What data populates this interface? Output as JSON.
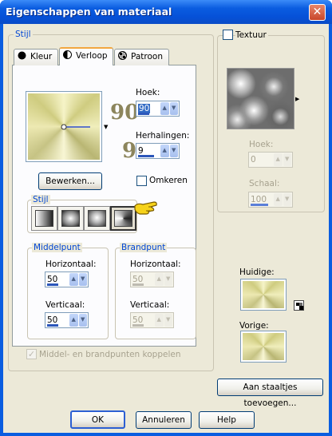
{
  "window": {
    "title": "Eigenschappen van materiaal",
    "close_glyph": "✕"
  },
  "style_group": {
    "label": "Stijl"
  },
  "tabs": [
    {
      "label": "Kleur",
      "icon": "circle-icon"
    },
    {
      "label": "Verloop",
      "icon": "gradient-icon"
    },
    {
      "label": "Patroon",
      "icon": "pattern-icon"
    }
  ],
  "gradient": {
    "angle_label": "Hoek:",
    "angle_value": "90",
    "angle_big": "90",
    "repeats_label": "Herhalingen:",
    "repeats_value": "9",
    "repeats_big": "9",
    "edit_button": "Bewerken...",
    "invert_label": "Omkeren",
    "substyle_label": "Stijl"
  },
  "middelpunt": {
    "label": "Middelpunt",
    "horiz_label": "Horizontaal:",
    "horiz_value": "50",
    "vert_label": "Verticaal:",
    "vert_value": "50"
  },
  "brandpunt": {
    "label": "Brandpunt",
    "horiz_label": "Horizontaal:",
    "horiz_value": "50",
    "vert_label": "Verticaal:",
    "vert_value": "50"
  },
  "link_label": "Middel- en brandpunten koppelen",
  "texture": {
    "label": "Textuur",
    "angle_label": "Hoek:",
    "angle_value": "0",
    "scale_label": "Schaal:",
    "scale_value": "100"
  },
  "current_label": "Huidige:",
  "previous_label": "Vorige:",
  "add_swatches_button": "Aan staaltjes toevoegen...",
  "buttons": {
    "ok": "OK",
    "cancel": "Annuleren",
    "help": "Help"
  },
  "colors": {
    "title_bar": "#0a5ce0",
    "face": "#ece9d8",
    "group_label": "#0046d5",
    "gradient_light": "#f6f4c8",
    "gradient_dark": "#b9b673"
  }
}
